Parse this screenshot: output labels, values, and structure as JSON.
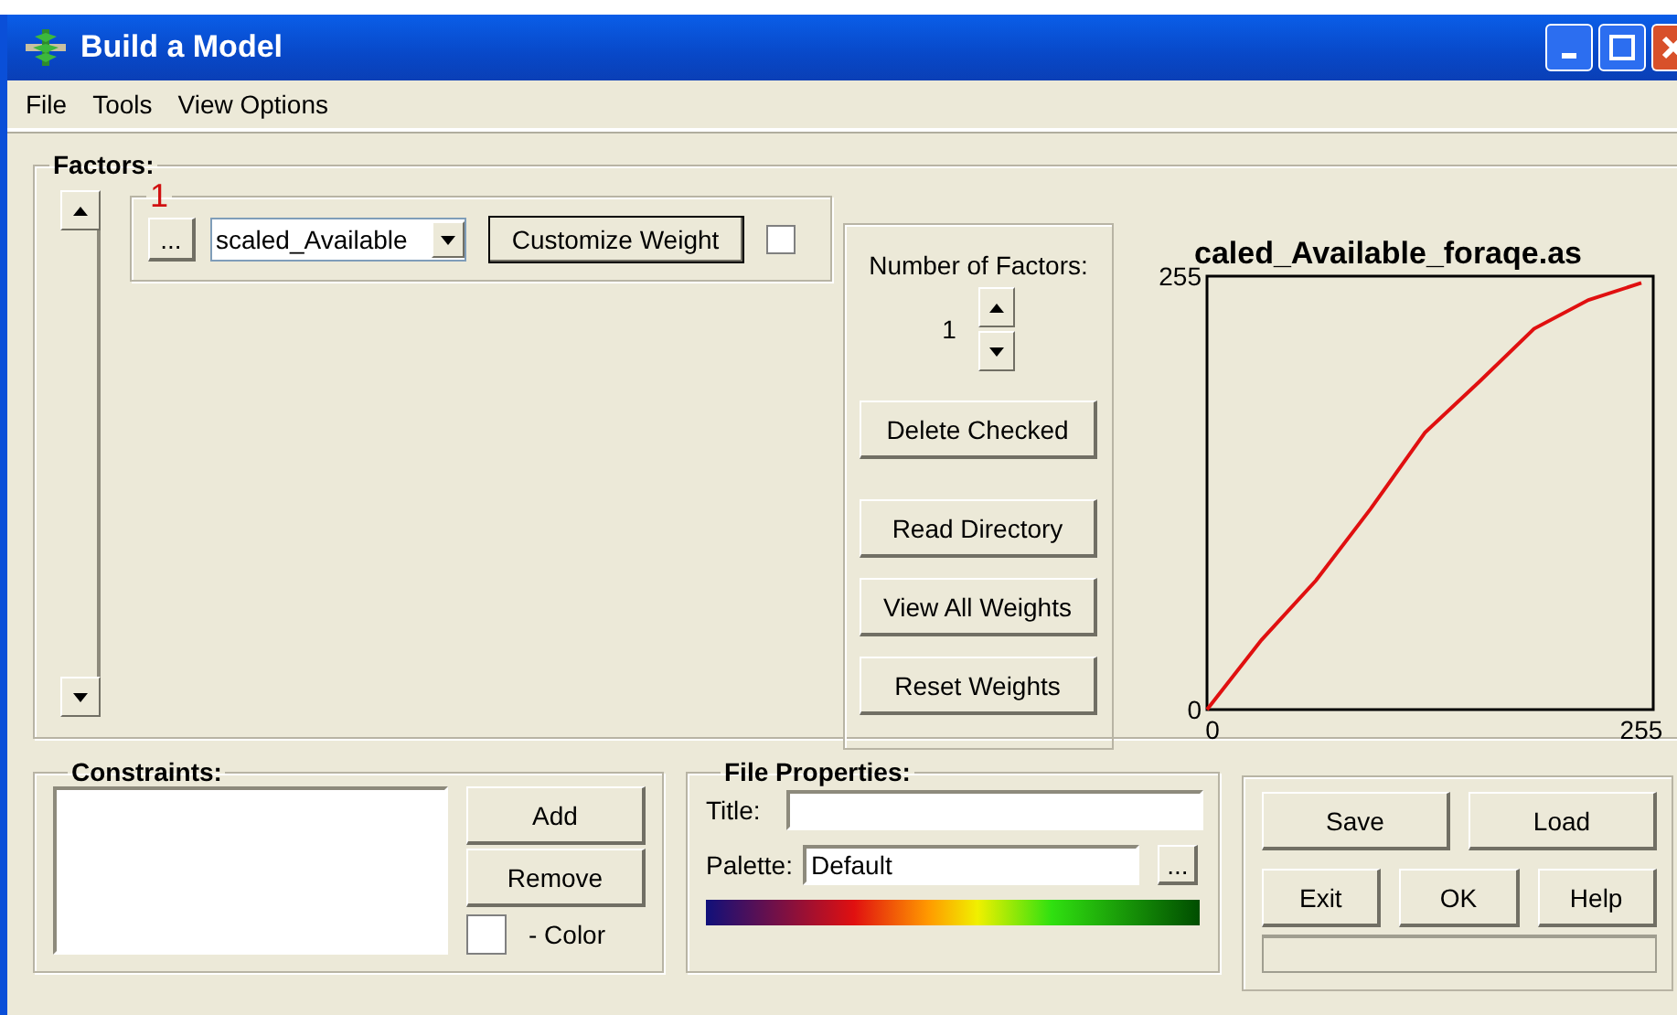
{
  "window": {
    "title": "Build a Model"
  },
  "menu": [
    "File",
    "Tools",
    "View Options"
  ],
  "factors": {
    "title": "Factors:",
    "items": [
      {
        "number": "1",
        "browse": "...",
        "file": "scaled_Available",
        "button": "Customize Weight",
        "checked": false
      }
    ],
    "count_label": "Number of Factors:",
    "count": "1",
    "buttons": [
      "Delete Checked",
      "Read Directory",
      "View All Weights",
      "Reset Weights"
    ],
    "chart_data": {
      "type": "line",
      "title": "caled_Available_foraqe.as",
      "x": [
        0,
        32,
        64,
        96,
        128,
        160,
        192,
        224,
        255
      ],
      "series": [
        {
          "color": "#e01010",
          "values": [
            0,
            41,
            76,
            118,
            163,
            193,
            224,
            241,
            251
          ]
        }
      ],
      "xlim": [
        0,
        262
      ],
      "ylim": [
        0,
        255
      ],
      "xticks": [
        0,
        255
      ],
      "yticks": [
        0,
        255
      ]
    }
  },
  "constraints": {
    "title": "Constraints:",
    "buttons": [
      "Add",
      "Remove"
    ],
    "color_label": "- Color",
    "color_checked": false
  },
  "file_properties": {
    "title": "File Properties:",
    "title_label": "Title:",
    "palette_label": "Palette:",
    "palette": "Default",
    "browse": "..."
  },
  "actions": [
    [
      "Save",
      "Load"
    ],
    [
      "Exit",
      "OK",
      "Help"
    ]
  ]
}
